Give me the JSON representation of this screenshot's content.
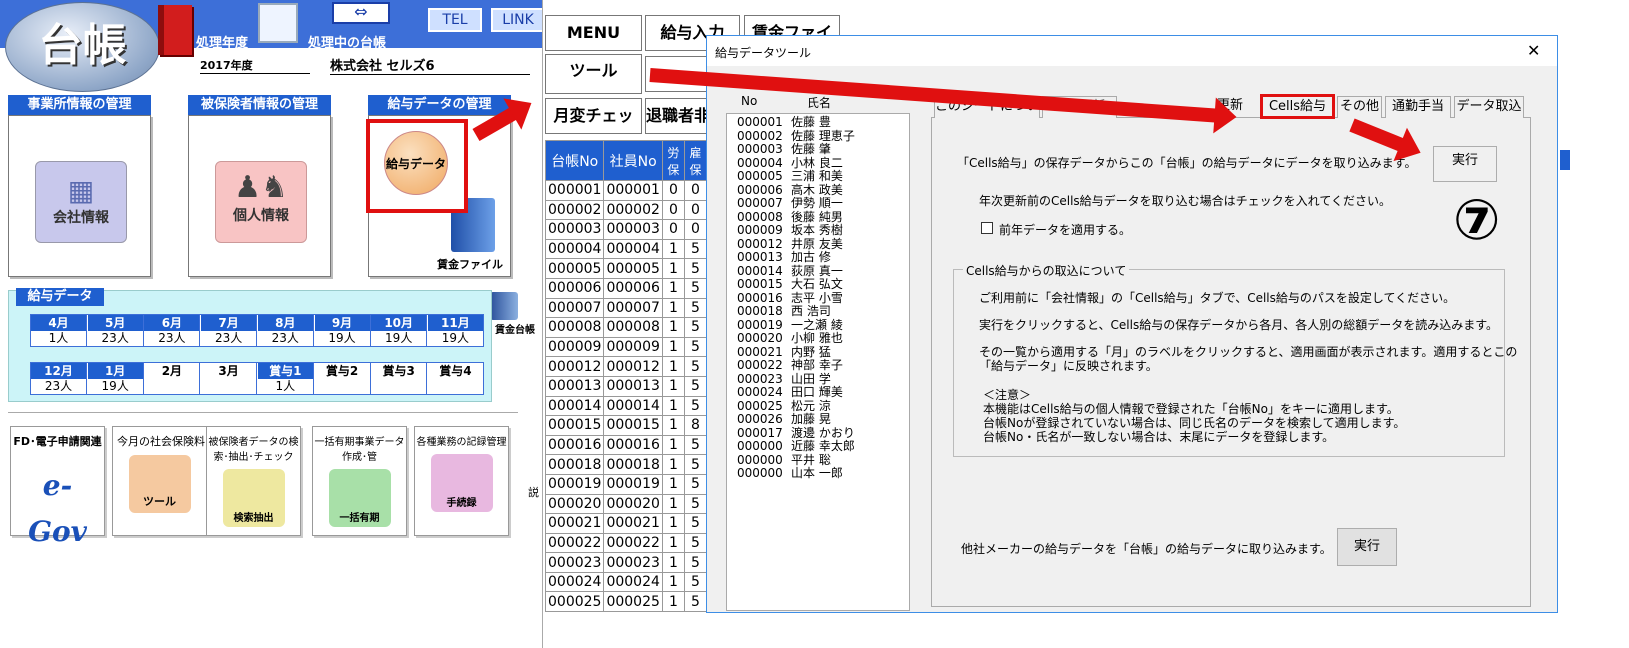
{
  "app": {
    "logo_text": "台帳",
    "year_label": "処理年度",
    "ledger_label": "処理中の台帳",
    "year_value": "2017年度",
    "company": "株式会社 セルズ6",
    "tel_button": "TEL",
    "link_button": "LINK"
  },
  "sections": {
    "office": "事業所情報の管理",
    "insured": "被保険者情報の管理",
    "salary": "給与データの管理"
  },
  "icons": {
    "company": "会社情報",
    "personal": "個人情報",
    "salary": "給与データ",
    "wage_file": "賃金ファイル",
    "wage_ledger": "賃金台帳"
  },
  "salary_data": {
    "title": "給与データ",
    "row1": [
      {
        "m": "4月",
        "v": "1人"
      },
      {
        "m": "5月",
        "v": "23人"
      },
      {
        "m": "6月",
        "v": "23人"
      },
      {
        "m": "7月",
        "v": "23人"
      },
      {
        "m": "8月",
        "v": "23人"
      },
      {
        "m": "9月",
        "v": "19人"
      },
      {
        "m": "10月",
        "v": "19人"
      },
      {
        "m": "11月",
        "v": "19人"
      }
    ],
    "row2": [
      {
        "m": "12月",
        "v": "23人"
      },
      {
        "m": "1月",
        "v": "19人"
      },
      {
        "m": "2月",
        "v": ""
      },
      {
        "m": "3月",
        "v": ""
      },
      {
        "m": "賞与1",
        "v": "1人"
      },
      {
        "m": "賞与2",
        "v": ""
      },
      {
        "m": "賞与3",
        "v": ""
      },
      {
        "m": "賞与4",
        "v": ""
      }
    ]
  },
  "bottom_icons": [
    {
      "title": "FD･電子申請関連",
      "label": "e-Gov"
    },
    {
      "title": "今月の社会保険料",
      "label": "ツール"
    },
    {
      "title": "被保険者データの検索･抽出･チェック",
      "label": "検索抽出"
    },
    {
      "title": "一括有期事業データ作成･管",
      "label": "一括有期"
    },
    {
      "title": "各種業務の記録管理",
      "label": "手続録"
    }
  ],
  "bottom_extra": "説",
  "menu": {
    "menu": "MENU",
    "salary_input": "給与入力",
    "wage_file": "賃金ファイル",
    "tool": "ツール",
    "monthly_check": "月変チェック",
    "retiree": "退職者非"
  },
  "grid": {
    "headers": [
      "台帳No",
      "社員No",
      "労保",
      "雇保"
    ],
    "rows": [
      [
        "000001",
        "000001",
        "0",
        "0"
      ],
      [
        "000002",
        "000002",
        "0",
        "0"
      ],
      [
        "000003",
        "000003",
        "0",
        "0"
      ],
      [
        "000004",
        "000004",
        "1",
        "5"
      ],
      [
        "000005",
        "000005",
        "1",
        "5"
      ],
      [
        "000006",
        "000006",
        "1",
        "5"
      ],
      [
        "000007",
        "000007",
        "1",
        "5"
      ],
      [
        "000008",
        "000008",
        "1",
        "5"
      ],
      [
        "000009",
        "000009",
        "1",
        "5"
      ],
      [
        "000012",
        "000012",
        "1",
        "5"
      ],
      [
        "000013",
        "000013",
        "1",
        "5"
      ],
      [
        "000014",
        "000014",
        "1",
        "5"
      ],
      [
        "000015",
        "000015",
        "1",
        "8"
      ],
      [
        "000016",
        "000016",
        "1",
        "5"
      ],
      [
        "000018",
        "000018",
        "1",
        "5"
      ],
      [
        "000019",
        "000019",
        "1",
        "5"
      ],
      [
        "000020",
        "000020",
        "1",
        "5"
      ],
      [
        "000021",
        "000021",
        "1",
        "5"
      ],
      [
        "000022",
        "000022",
        "1",
        "5"
      ],
      [
        "000023",
        "000023",
        "1",
        "5"
      ],
      [
        "000024",
        "000024",
        "1",
        "5"
      ],
      [
        "000025",
        "000025",
        "1",
        "5"
      ]
    ]
  },
  "dialog": {
    "title": "給与データツール",
    "close": "✕",
    "list_headers": {
      "no": "No",
      "name": "氏名"
    },
    "employees": [
      {
        "no": "000001",
        "name": "佐藤 豊"
      },
      {
        "no": "000002",
        "name": "佐藤 理恵子"
      },
      {
        "no": "000003",
        "name": "佐藤 肇"
      },
      {
        "no": "000004",
        "name": "小林 良二"
      },
      {
        "no": "000005",
        "name": "三浦 和美"
      },
      {
        "no": "000006",
        "name": "高木 政美"
      },
      {
        "no": "000007",
        "name": "伊勢 順一"
      },
      {
        "no": "000008",
        "name": "後藤 純男"
      },
      {
        "no": "000009",
        "name": "坂本 秀樹"
      },
      {
        "no": "000012",
        "name": "井原 友美"
      },
      {
        "no": "000013",
        "name": "加古 修"
      },
      {
        "no": "000014",
        "name": "荻原 真一"
      },
      {
        "no": "000015",
        "name": "大石 弘文"
      },
      {
        "no": "000016",
        "name": "志平 小雪"
      },
      {
        "no": "000018",
        "name": "西 浩司"
      },
      {
        "no": "000019",
        "name": "一之瀬 綾"
      },
      {
        "no": "000020",
        "name": "小柳 雅也"
      },
      {
        "no": "000021",
        "name": "内野 猛"
      },
      {
        "no": "000022",
        "name": "神部 幸子"
      },
      {
        "no": "000023",
        "name": "山田 学"
      },
      {
        "no": "000024",
        "name": "田口 輝美"
      },
      {
        "no": "000025",
        "name": "松元 涼"
      },
      {
        "no": "000026",
        "name": "加藤 晃"
      },
      {
        "no": "000017",
        "name": "渡邊 かおり"
      },
      {
        "no": "000000",
        "name": "近藤 幸太郎"
      },
      {
        "no": "000000",
        "name": "平井 聡"
      },
      {
        "no": "000000",
        "name": "山本 一郎"
      }
    ],
    "tabs": [
      "このシートについて",
      "月次更新",
      "更新",
      "Cells給与",
      "その他",
      "通勤手当",
      "データ取込"
    ],
    "intro": "「Cells給与」の保存データからこの「台帳」の給与データにデータを取り込みます。",
    "execute": "実行",
    "step": "⑦",
    "year_note": "年次更新前のCells給与データを取り込む場合はチェックを入れてください。",
    "checkbox_label": "前年データを適用する。",
    "group_title": "Cells給与からの取込について",
    "p1": "ご利用前に「会社情報」の「Cells給与」タブで、Cells給与のパスを設定してください。",
    "p2": "実行をクリックすると、Cells給与の保存データから各月、各人別の総額データを読み込みます。",
    "p3a": "その一覧から適用する「月」のラベルをクリックすると、適用画面が表示されます。適用するとこの",
    "p3b": "「給与データ」に反映されます。",
    "note_title": "＜注意＞",
    "n1": "本機能はCells給与の個人情報で登録された「台帳No」をキーに適用します。",
    "n2": "台帳Noが登録されていない場合は、同じ氏名のデータを検索して適用します。",
    "n3": "台帳No・氏名が一致しない場合は、末尾にデータを登録します。",
    "other_text": "他社メーカーの給与データを「台帳」の給与データに取り込みます。",
    "other_execute": "実行"
  },
  "colors": {
    "brand_blue": "#1f5fcf",
    "highlight_red": "#e01010"
  }
}
